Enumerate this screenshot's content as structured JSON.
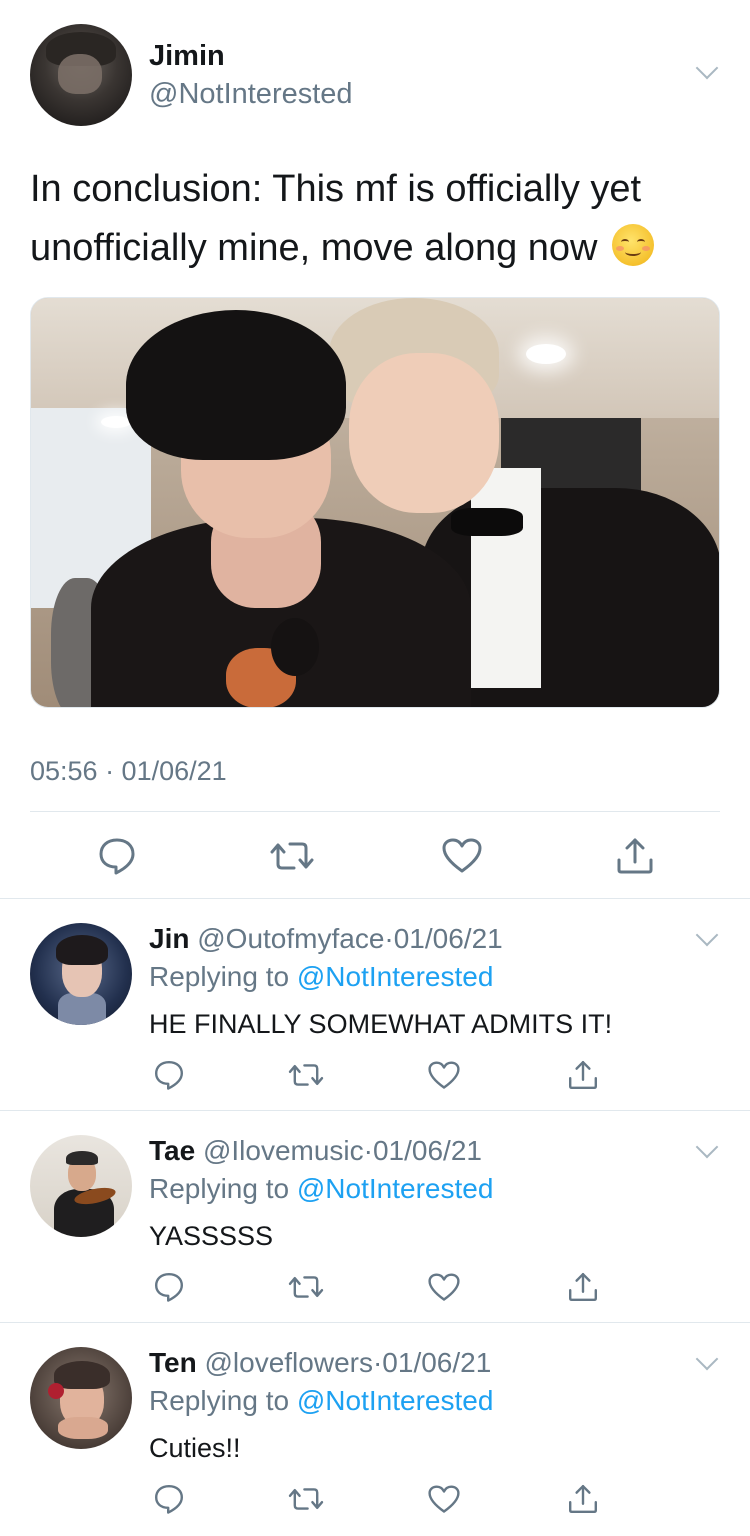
{
  "main_tweet": {
    "author_name": "Jimin",
    "author_handle": "@NotInterested",
    "text": "In conclusion: This mf is officially yet unofficially mine, move along now",
    "emoji": "☺️",
    "timestamp": "05:56 · 01/06/21",
    "actions": [
      "reply-icon",
      "retweet-icon",
      "like-icon",
      "share-icon"
    ]
  },
  "replies": [
    {
      "name": "Jin",
      "handle": "@Outofmyface",
      "dot": "·",
      "date": "01/06/21",
      "replying_prefix": "Replying to ",
      "replying_to": "@NotInterested",
      "text": "HE FINALLY SOMEWHAT ADMITS IT!"
    },
    {
      "name": "Tae",
      "handle": "@Ilovemusic",
      "dot": "·",
      "date": "01/06/21",
      "replying_prefix": "Replying to ",
      "replying_to": "@NotInterested",
      "text": "YASSSSS"
    },
    {
      "name": "Ten",
      "handle": "@loveflowers",
      "dot": "·",
      "date": "01/06/21",
      "replying_prefix": "Replying to ",
      "replying_to": "@NotInterested",
      "text": "Cuties!!"
    }
  ],
  "colors": {
    "text": "#14171a",
    "secondary": "#657786",
    "link": "#1da1f2",
    "icon": "#657786",
    "divider": "#e1e8ed"
  }
}
